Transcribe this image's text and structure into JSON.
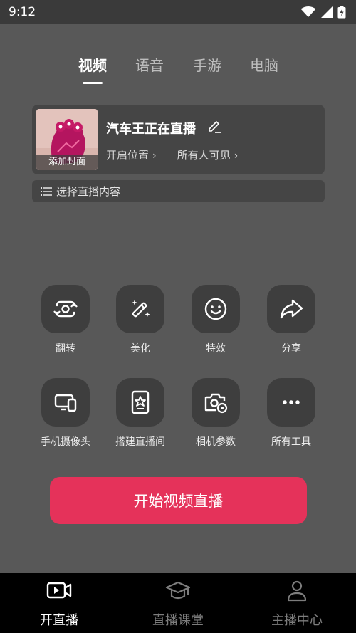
{
  "status_bar": {
    "time": "9:12"
  },
  "tabs": [
    {
      "label": "视频",
      "active": true
    },
    {
      "label": "语音",
      "active": false
    },
    {
      "label": "手游",
      "active": false
    },
    {
      "label": "电脑",
      "active": false
    }
  ],
  "stream": {
    "cover_label": "添加封面",
    "title": "汽车王正在直播",
    "location_label": "开启位置",
    "visibility_label": "所有人可见"
  },
  "select_content": {
    "label": "选择直播内容"
  },
  "tools": [
    {
      "label": "翻转",
      "icon": "flip-camera-icon"
    },
    {
      "label": "美化",
      "icon": "magic-wand-icon"
    },
    {
      "label": "特效",
      "icon": "smiley-effect-icon"
    },
    {
      "label": "分享",
      "icon": "share-arrow-icon"
    },
    {
      "label": "手机摄像头",
      "icon": "phone-camera-icon"
    },
    {
      "label": "搭建直播间",
      "icon": "room-setup-icon"
    },
    {
      "label": "相机参数",
      "icon": "camera-settings-icon"
    },
    {
      "label": "所有工具",
      "icon": "more-dots-icon"
    }
  ],
  "start_button": {
    "label": "开始视频直播",
    "color": "#e5325a"
  },
  "bottom_nav": [
    {
      "label": "开直播",
      "icon": "live-camera-icon",
      "active": true
    },
    {
      "label": "直播课堂",
      "icon": "graduation-cap-icon",
      "active": false
    },
    {
      "label": "主播中心",
      "icon": "person-icon",
      "active": false
    }
  ]
}
